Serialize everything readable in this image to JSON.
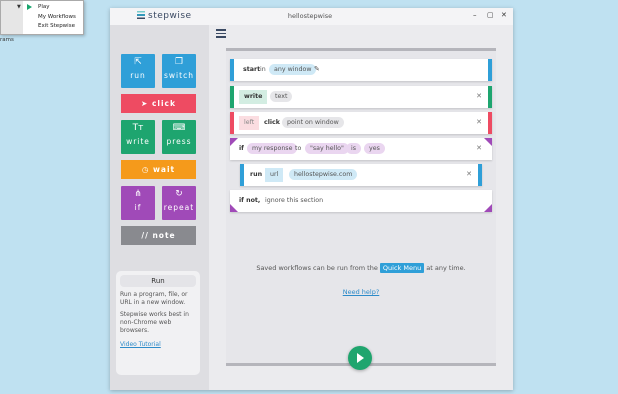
{
  "context_menu": {
    "items": [
      "Play",
      "My Workflows",
      "Exit Stepwise"
    ]
  },
  "desktop_text": "rams",
  "window": {
    "logo": "stepwise",
    "title": "hellostepwise",
    "controls": {
      "minimize": "–",
      "maximize": "▢",
      "close": "✕"
    }
  },
  "tiles": {
    "run": "run",
    "switch": "switch",
    "click": "click",
    "write": "write",
    "press": "press",
    "wait": "wait",
    "if": "if",
    "repeat": "repeat",
    "note": "// note"
  },
  "run_panel": {
    "title": "Run",
    "desc": "Run a program, file, or URL in a new window.",
    "note": "Stepwise works best in non-Chrome web browsers.",
    "link": "Video Tutorial"
  },
  "workflow": {
    "start": {
      "kw": "start",
      "in": "in",
      "window": "any window"
    },
    "write": {
      "kw": "write",
      "value": "text"
    },
    "click": {
      "side": "left",
      "kw": "click",
      "target": "point on window"
    },
    "if": {
      "kw": "if",
      "subject": "my response",
      "to": "to",
      "value": "\"say hello\"",
      "is": "is",
      "answer": "yes"
    },
    "run": {
      "kw": "run",
      "type": "url",
      "value": "hellostepwise.com"
    },
    "if_not": {
      "kw": "if not,",
      "rest": "ignore this section"
    }
  },
  "info": {
    "before": "Saved workflows can be run from the",
    "quick_menu": "Quick Menu",
    "after": "at any time.",
    "help": "Need help?"
  }
}
